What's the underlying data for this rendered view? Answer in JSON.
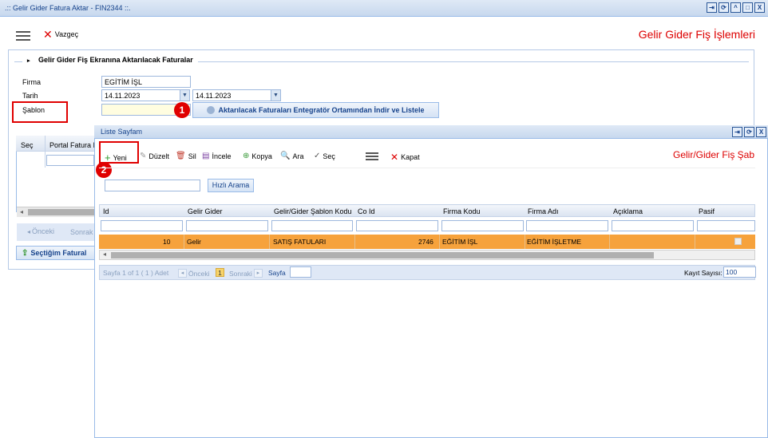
{
  "window": {
    "title": ".:: Gelir Gider Fatura Aktar - FIN2344 ::.",
    "buttons": [
      "⇥",
      "⟳",
      "^",
      "□",
      "X"
    ]
  },
  "toolbar": {
    "cancel_label": "Vazgeç",
    "page_title": "Gelir Gider Fiş İşlemleri"
  },
  "form": {
    "legend": "Gelir Gider Fiş Ekranına Aktarılacak Faturalar",
    "firma_label": "Firma",
    "firma_value": "EGİTİM İŞL",
    "tarih_label": "Tarih",
    "tarih_start": "14.11.2023",
    "tarih_end": "14.11.2023",
    "sablon_label": "Şablon",
    "sablon_value": "",
    "list_button": "Aktarılacak Faturaları Entegratör Ortamından İndir ve Listele"
  },
  "behind": {
    "col_sec": "Seç",
    "col_portal": "Portal Fatura I",
    "prev": "Önceki",
    "next": "Sonrak",
    "selected_btn": "Seçtiğim Fatural"
  },
  "badges": {
    "one": "1",
    "two": "2"
  },
  "dialog": {
    "title": "Liste Sayfam",
    "buttons": [
      "⇥",
      "⟳",
      "X"
    ],
    "toolbar": {
      "new": "Yeni",
      "edit": "Düzelt",
      "delete": "Sil",
      "inspect": "İncele",
      "copy": "Kopya",
      "search": "Ara",
      "select": "Seç",
      "close": "Kapat"
    },
    "heading": "Gelir/Gider Fiş Şab",
    "search_placeholder": "",
    "quick_search": "Hızlı Arama",
    "columns": [
      "Id",
      "Gelir Gider",
      "Gelir/Gider Şablon Kodu",
      "Co Id",
      "Firma Kodu",
      "Firma Adı",
      "Açıklama",
      "Pasif"
    ],
    "row": {
      "id": "10",
      "gelir_gider": "Gelir",
      "sablon_kodu": "SATIŞ FATULARI",
      "co_id": "2746",
      "firma_kodu": "EĞİTİM İŞL",
      "firma_adi": "EĞİTİM İŞLETME",
      "aciklama": ""
    },
    "pager": {
      "info": "Sayfa 1 of 1 ( 1 ) Adet",
      "prev": "Önceki",
      "page_num": "1",
      "next": "Sonraki",
      "page_label": "Sayfa",
      "count_label": "Kayıt Sayısı:",
      "count_value": "100"
    }
  }
}
